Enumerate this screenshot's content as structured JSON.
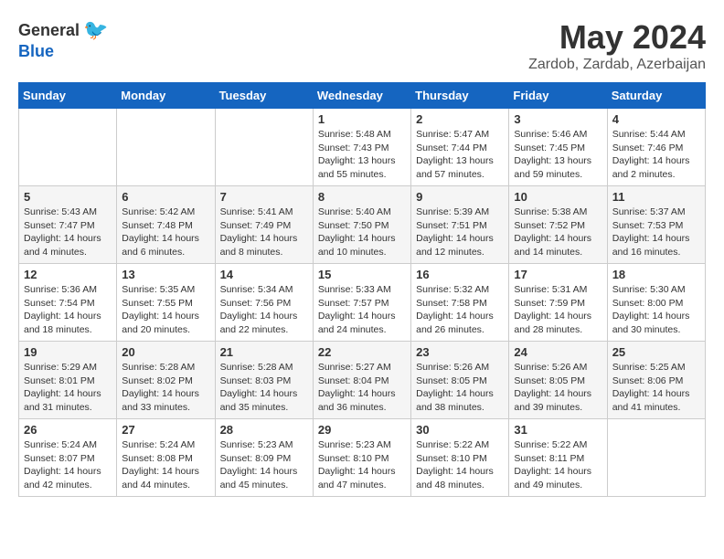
{
  "header": {
    "logo_general": "General",
    "logo_blue": "Blue",
    "month_year": "May 2024",
    "location": "Zardob, Zardab, Azerbaijan"
  },
  "days_of_week": [
    "Sunday",
    "Monday",
    "Tuesday",
    "Wednesday",
    "Thursday",
    "Friday",
    "Saturday"
  ],
  "weeks": [
    [
      {
        "day": "",
        "info": ""
      },
      {
        "day": "",
        "info": ""
      },
      {
        "day": "",
        "info": ""
      },
      {
        "day": "1",
        "info": "Sunrise: 5:48 AM\nSunset: 7:43 PM\nDaylight: 13 hours\nand 55 minutes."
      },
      {
        "day": "2",
        "info": "Sunrise: 5:47 AM\nSunset: 7:44 PM\nDaylight: 13 hours\nand 57 minutes."
      },
      {
        "day": "3",
        "info": "Sunrise: 5:46 AM\nSunset: 7:45 PM\nDaylight: 13 hours\nand 59 minutes."
      },
      {
        "day": "4",
        "info": "Sunrise: 5:44 AM\nSunset: 7:46 PM\nDaylight: 14 hours\nand 2 minutes."
      }
    ],
    [
      {
        "day": "5",
        "info": "Sunrise: 5:43 AM\nSunset: 7:47 PM\nDaylight: 14 hours\nand 4 minutes."
      },
      {
        "day": "6",
        "info": "Sunrise: 5:42 AM\nSunset: 7:48 PM\nDaylight: 14 hours\nand 6 minutes."
      },
      {
        "day": "7",
        "info": "Sunrise: 5:41 AM\nSunset: 7:49 PM\nDaylight: 14 hours\nand 8 minutes."
      },
      {
        "day": "8",
        "info": "Sunrise: 5:40 AM\nSunset: 7:50 PM\nDaylight: 14 hours\nand 10 minutes."
      },
      {
        "day": "9",
        "info": "Sunrise: 5:39 AM\nSunset: 7:51 PM\nDaylight: 14 hours\nand 12 minutes."
      },
      {
        "day": "10",
        "info": "Sunrise: 5:38 AM\nSunset: 7:52 PM\nDaylight: 14 hours\nand 14 minutes."
      },
      {
        "day": "11",
        "info": "Sunrise: 5:37 AM\nSunset: 7:53 PM\nDaylight: 14 hours\nand 16 minutes."
      }
    ],
    [
      {
        "day": "12",
        "info": "Sunrise: 5:36 AM\nSunset: 7:54 PM\nDaylight: 14 hours\nand 18 minutes."
      },
      {
        "day": "13",
        "info": "Sunrise: 5:35 AM\nSunset: 7:55 PM\nDaylight: 14 hours\nand 20 minutes."
      },
      {
        "day": "14",
        "info": "Sunrise: 5:34 AM\nSunset: 7:56 PM\nDaylight: 14 hours\nand 22 minutes."
      },
      {
        "day": "15",
        "info": "Sunrise: 5:33 AM\nSunset: 7:57 PM\nDaylight: 14 hours\nand 24 minutes."
      },
      {
        "day": "16",
        "info": "Sunrise: 5:32 AM\nSunset: 7:58 PM\nDaylight: 14 hours\nand 26 minutes."
      },
      {
        "day": "17",
        "info": "Sunrise: 5:31 AM\nSunset: 7:59 PM\nDaylight: 14 hours\nand 28 minutes."
      },
      {
        "day": "18",
        "info": "Sunrise: 5:30 AM\nSunset: 8:00 PM\nDaylight: 14 hours\nand 30 minutes."
      }
    ],
    [
      {
        "day": "19",
        "info": "Sunrise: 5:29 AM\nSunset: 8:01 PM\nDaylight: 14 hours\nand 31 minutes."
      },
      {
        "day": "20",
        "info": "Sunrise: 5:28 AM\nSunset: 8:02 PM\nDaylight: 14 hours\nand 33 minutes."
      },
      {
        "day": "21",
        "info": "Sunrise: 5:28 AM\nSunset: 8:03 PM\nDaylight: 14 hours\nand 35 minutes."
      },
      {
        "day": "22",
        "info": "Sunrise: 5:27 AM\nSunset: 8:04 PM\nDaylight: 14 hours\nand 36 minutes."
      },
      {
        "day": "23",
        "info": "Sunrise: 5:26 AM\nSunset: 8:05 PM\nDaylight: 14 hours\nand 38 minutes."
      },
      {
        "day": "24",
        "info": "Sunrise: 5:26 AM\nSunset: 8:05 PM\nDaylight: 14 hours\nand 39 minutes."
      },
      {
        "day": "25",
        "info": "Sunrise: 5:25 AM\nSunset: 8:06 PM\nDaylight: 14 hours\nand 41 minutes."
      }
    ],
    [
      {
        "day": "26",
        "info": "Sunrise: 5:24 AM\nSunset: 8:07 PM\nDaylight: 14 hours\nand 42 minutes."
      },
      {
        "day": "27",
        "info": "Sunrise: 5:24 AM\nSunset: 8:08 PM\nDaylight: 14 hours\nand 44 minutes."
      },
      {
        "day": "28",
        "info": "Sunrise: 5:23 AM\nSunset: 8:09 PM\nDaylight: 14 hours\nand 45 minutes."
      },
      {
        "day": "29",
        "info": "Sunrise: 5:23 AM\nSunset: 8:10 PM\nDaylight: 14 hours\nand 47 minutes."
      },
      {
        "day": "30",
        "info": "Sunrise: 5:22 AM\nSunset: 8:10 PM\nDaylight: 14 hours\nand 48 minutes."
      },
      {
        "day": "31",
        "info": "Sunrise: 5:22 AM\nSunset: 8:11 PM\nDaylight: 14 hours\nand 49 minutes."
      },
      {
        "day": "",
        "info": ""
      }
    ]
  ]
}
